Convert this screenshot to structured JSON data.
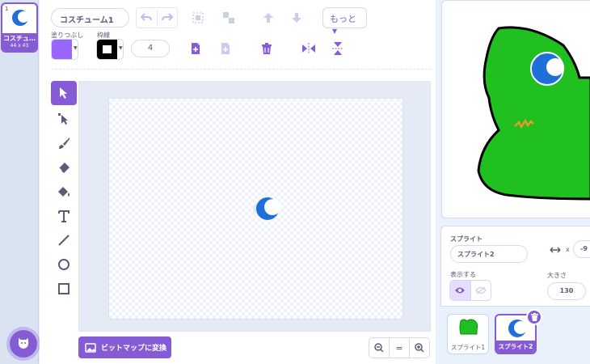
{
  "costume_list": {
    "items": [
      {
        "number": "1",
        "name": "コスチュ…",
        "size": "44 x 43"
      }
    ]
  },
  "toolbar": {
    "costume_name": "コスチューム1",
    "more_label": "もっと",
    "fill_label": "塗りつぶし",
    "outline_label": "枠線",
    "outline_width": "4"
  },
  "canvas": {
    "convert_bitmap_label": "ビットマップに変換",
    "zoom_reset_label": "="
  },
  "sprite_info": {
    "sprite_label": "スプライト",
    "sprite_name": "スプライト2",
    "x_label": "x",
    "x_value": "-9",
    "show_label": "表示する",
    "size_label": "大きさ",
    "size_value": "130"
  },
  "sprites": [
    {
      "name": "スプライト1"
    },
    {
      "name": "スプライト2"
    }
  ],
  "colors": {
    "accent": "#855cd6",
    "fill_swatch": "#9966ff",
    "outline_swatch": "#000000",
    "sprite_green": "#20c020",
    "sprite_blue": "#1e88e5"
  }
}
